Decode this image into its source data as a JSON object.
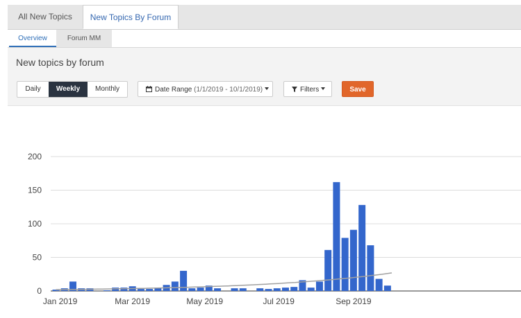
{
  "tabs": {
    "top": [
      "All New Topics",
      "New Topics By Forum"
    ],
    "sub": [
      "Overview",
      "Forum MM"
    ]
  },
  "panel": {
    "title": "New topics by forum",
    "granularity": [
      "Daily",
      "Weekly",
      "Monthly"
    ],
    "selected_granularity": "Weekly",
    "date_range_label": "Date Range",
    "date_range_value": "(1/1/2019 - 10/1/2019)",
    "filters_label": "Filters",
    "save_label": "Save"
  },
  "icons": {
    "date_range": "calendar-icon",
    "filters": "filter-icon",
    "dropdown": "caret-down-icon"
  },
  "colors": {
    "active_tab": "#3467b0",
    "weekly_selected": "#2a3340",
    "save": "#e1662a",
    "bars": "#3366cc",
    "trend": "#a0a0a0"
  },
  "chart_data": {
    "type": "bar",
    "title": "",
    "xlabel": "",
    "ylabel": "",
    "ylim": [
      0,
      200
    ],
    "yticks": [
      0,
      50,
      100,
      150,
      200
    ],
    "grid": true,
    "trendline": {
      "type": "exponential",
      "start": 2,
      "end": 26
    },
    "x_tick_labels": [
      {
        "label": "Jan 2019",
        "week": 0.5
      },
      {
        "label": "Mar 2019",
        "week": 9.0
      },
      {
        "label": "May 2019",
        "week": 17.5
      },
      {
        "label": "Jul 2019",
        "week": 26.2
      },
      {
        "label": "Sep 2019",
        "week": 35.0
      }
    ],
    "series": [
      {
        "values": [
          2,
          4,
          14,
          4,
          4,
          0,
          1,
          5,
          5,
          7,
          3,
          3,
          5,
          9,
          14,
          30,
          4,
          5,
          8,
          4,
          0,
          4,
          4,
          0,
          4,
          3,
          4,
          5,
          6,
          16,
          5,
          14,
          61,
          162,
          79,
          91,
          128,
          68,
          18,
          8
        ]
      }
    ]
  }
}
